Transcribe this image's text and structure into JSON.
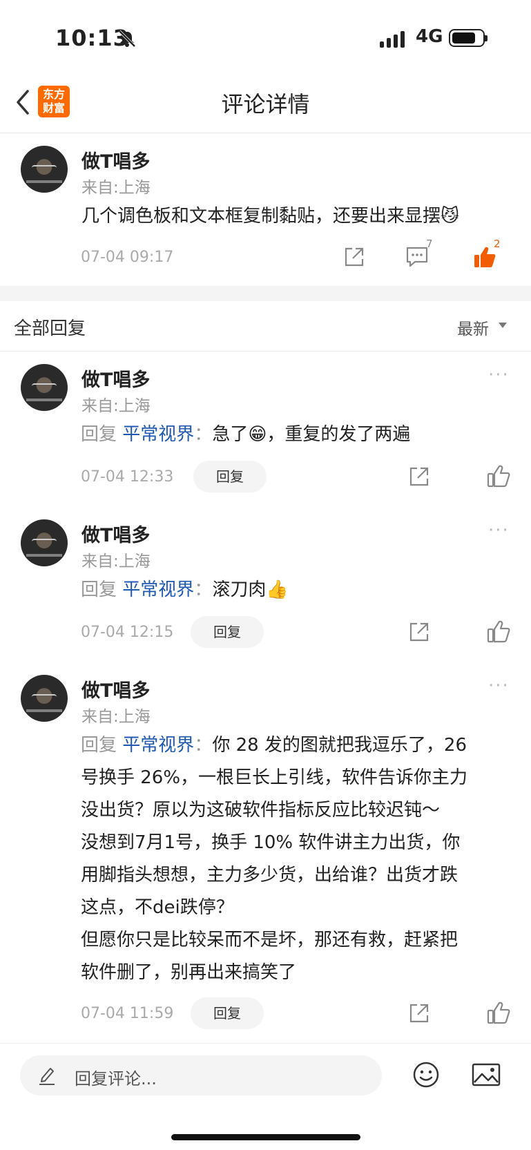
{
  "status_bar": {
    "time": "10:13",
    "network": "4G"
  },
  "nav": {
    "logo_line1": "东方",
    "logo_line2": "财富",
    "title": "评论详情"
  },
  "main_comment": {
    "author": "做T唱多",
    "location": "来自:上海",
    "text": "几个调色板和文本框复制黏贴，还要出来显摆",
    "emoji": "😼",
    "time": "07-04 09:17",
    "comment_count": "7",
    "like_count": "2"
  },
  "replies_header": {
    "title": "全部回复",
    "sort": "最新"
  },
  "replies": [
    {
      "author": "做T唱多",
      "location": "来自:上海",
      "reply_lead": "回复",
      "reply_to": "平常视界",
      "colon": "：",
      "text": "急了😁，重复的发了两遍",
      "time": "07-04 12:33",
      "reply_label": "回复",
      "more": "···"
    },
    {
      "author": "做T唱多",
      "location": "来自:上海",
      "reply_lead": "回复",
      "reply_to": "平常视界",
      "colon": "：",
      "text": "滚刀肉👍",
      "time": "07-04 12:15",
      "reply_label": "回复",
      "more": "···"
    },
    {
      "author": "做T唱多",
      "location": "来自:上海",
      "reply_lead": "回复",
      "reply_to": "平常视界",
      "colon": "：",
      "line1": "你 28 发的图就把我逗乐了，26",
      "line2": "号换手 26%，一根巨长上引线，软件告诉你主力",
      "line3": "没出货？原以为这破软件指标反应比较迟钝～",
      "line4": "没想到7月1号，换手 10% 软件讲主力出货，你",
      "line5": "用脚指头想想，主力多少货，出给谁？出货才跌",
      "line6": "这点，不dei跌停？",
      "line7": "但愿你只是比较呆而不是坏，那还有救，赶紧把",
      "line8": "软件删了，别再出来搞笑了",
      "time": "07-04 11:59",
      "reply_label": "回复",
      "more": "···"
    }
  ],
  "bottom_bar": {
    "placeholder": "回复评论..."
  }
}
